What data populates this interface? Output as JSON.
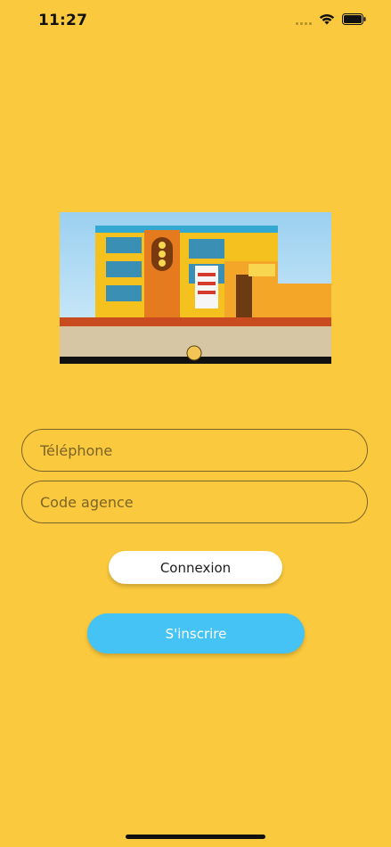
{
  "status_bar": {
    "time": "11:27"
  },
  "hero": {
    "image_description": "building"
  },
  "form": {
    "phone_placeholder": "Téléphone",
    "agency_placeholder": "Code agence"
  },
  "buttons": {
    "login_label": "Connexion",
    "register_label": "S'inscrire"
  },
  "colors": {
    "background": "#fbc93d",
    "login_button": "#ffffff",
    "register_button": "#45c3f4",
    "field_border": "#7b6428"
  },
  "icons": {
    "signal": "signal-icon",
    "wifi": "wifi-icon",
    "battery": "battery-icon"
  }
}
